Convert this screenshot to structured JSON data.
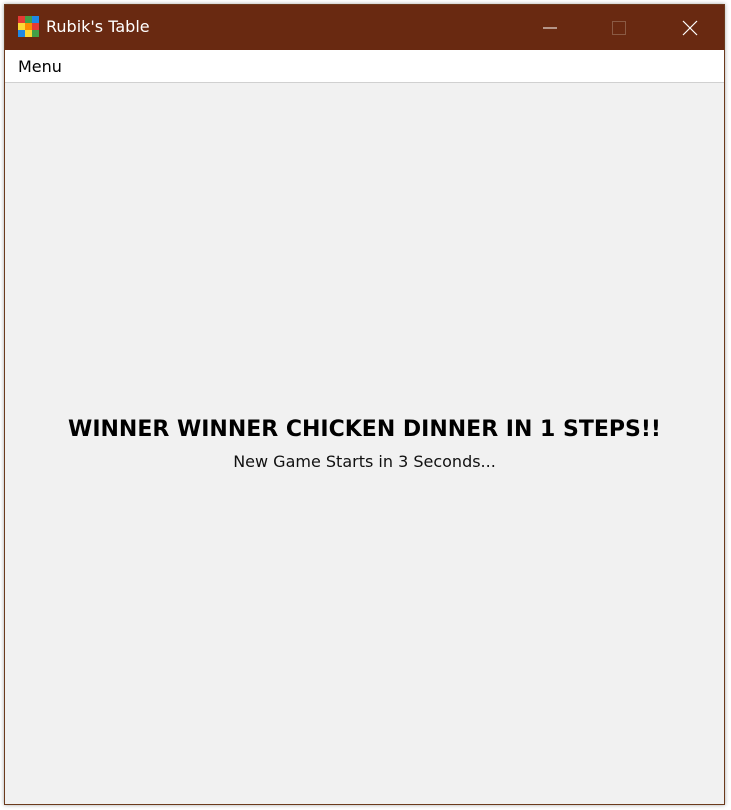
{
  "window": {
    "title": "Rubik's Table",
    "icon": "rubiks-cube-icon",
    "controls": {
      "minimize": "minimize-icon",
      "maximize": "maximize-icon",
      "close": "close-icon"
    },
    "titlebar_color": "#692911"
  },
  "menubar": {
    "items": [
      {
        "label": "Menu"
      }
    ]
  },
  "main": {
    "headline": "WINNER WINNER CHICKEN DINNER IN 1 STEPS!!",
    "subtext": "New Game Starts in 3 Seconds..."
  },
  "icon_colors": {
    "cube": [
      "#e53935",
      "#43a047",
      "#1e88e5",
      "#fdd835",
      "#fb8c00",
      "#e53935",
      "#1e88e5",
      "#fdd835",
      "#43a047"
    ]
  }
}
